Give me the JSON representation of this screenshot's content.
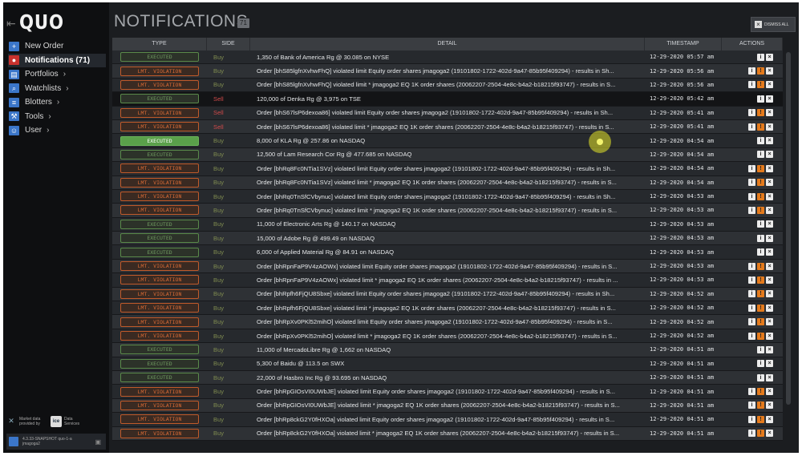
{
  "app": {
    "logo": "QUO"
  },
  "sidebar": {
    "items": [
      {
        "label": "New Order",
        "icon": "plus-icon",
        "chevron": ""
      },
      {
        "label": "Notifications (71)",
        "icon": "bell-icon",
        "chevron": ""
      },
      {
        "label": "Portfolios",
        "icon": "folder-icon",
        "chevron": "›"
      },
      {
        "label": "Watchlists",
        "icon": "search-icon",
        "chevron": "›"
      },
      {
        "label": "Blotters",
        "icon": "blotter-icon",
        "chevron": "›"
      },
      {
        "label": "Tools",
        "icon": "tools-icon",
        "chevron": "›"
      },
      {
        "label": "User",
        "icon": "user-icon",
        "chevron": "›"
      }
    ],
    "market_data": {
      "line1": "Market data",
      "line2": "provided by",
      "brand": "ice",
      "provider1": "Data",
      "provider2": "Services"
    },
    "version": {
      "line1": "4.3.33-SNAPSHOT quo-1-a",
      "line2": "jmagoga2"
    }
  },
  "header": {
    "title": "NOTIFICATIONS",
    "count": "71",
    "dismiss_label": "DISMISS ALL"
  },
  "table": {
    "columns": {
      "type": "TYPE",
      "side": "SIDE",
      "detail": "DETAIL",
      "timestamp": "TIMESTAMP",
      "actions": "ACTIONS"
    },
    "rows": [
      {
        "type": "EXECUTED",
        "side": "Buy",
        "detail": "1,350 of Bank of America Rg @ 30.085 on NYSE",
        "ts": "12-29-2020 05:57 am"
      },
      {
        "type": "LMT. VIOLATION",
        "side": "Buy",
        "detail": "Order [bhS85lgfnXvhwFhQ] violated limit Equity order shares jmagoga2 (19101802-1722-402d-9a47-85b95f409294) - results in Sh...",
        "ts": "12-29-2020 05:56 am"
      },
      {
        "type": "LMT. VIOLATION",
        "side": "Buy",
        "detail": "Order [bhS85lgfnXvhwFhQ] violated limit * jmagoga2 EQ 1K order shares (20062207-2504-4e8c-b4a2-b18215f93747) - results in S...",
        "ts": "12-29-2020 05:56 am"
      },
      {
        "type": "EXECUTED",
        "side": "Sell",
        "detail": "120,000 of Denka Rg @ 3,975 on TSE",
        "ts": "12-29-2020 05:42 am"
      },
      {
        "type": "LMT. VIOLATION",
        "side": "Sell",
        "detail": "Order [bhS67lsP6dexoa86] violated limit Equity order shares jmagoga2 (19101802-1722-402d-9a47-85b95f409294) - results in Sh...",
        "ts": "12-29-2020 05:41 am"
      },
      {
        "type": "LMT. VIOLATION",
        "side": "Sell",
        "detail": "Order [bhS67lsP6dexoa86] violated limit * jmagoga2 EQ 1K order shares (20062207-2504-4e8c-b4a2-b18215f93747) - results in S...",
        "ts": "12-29-2020 05:41 am"
      },
      {
        "type": "EXECUTED",
        "side": "Buy",
        "detail": "8,000 of KLA Rg @ 257.86 on NASDAQ",
        "ts": "12-29-2020 04:54 am"
      },
      {
        "type": "EXECUTED",
        "side": "Buy",
        "detail": "12,500 of Lam Research Cor Rg @ 477.685 on NASDAQ",
        "ts": "12-29-2020 04:54 am"
      },
      {
        "type": "LMT. VIOLATION",
        "side": "Buy",
        "detail": "Order [bhRq8Fc0NTia1SVz] violated limit Equity order shares jmagoga2 (19101802-1722-402d-9a47-85b95f409294) - results in Sh...",
        "ts": "12-29-2020 04:54 am"
      },
      {
        "type": "LMT. VIOLATION",
        "side": "Buy",
        "detail": "Order [bhRq8Fc0NTia1SVz] violated limit * jmagoga2 EQ 1K order shares (20062207-2504-4e8c-b4a2-b18215f93747) - results in S...",
        "ts": "12-29-2020 04:54 am"
      },
      {
        "type": "LMT. VIOLATION",
        "side": "Buy",
        "detail": "Order [bhRq0TnSfCVbynuc] violated limit Equity order shares jmagoga2 (19101802-1722-402d-9a47-85b95f409294) - results in Sh...",
        "ts": "12-29-2020 04:53 am"
      },
      {
        "type": "LMT. VIOLATION",
        "side": "Buy",
        "detail": "Order [bhRq0TnSfCVbynuc] violated limit * jmagoga2 EQ 1K order shares (20062207-2504-4e8c-b4a2-b18215f93747) - results in S...",
        "ts": "12-29-2020 04:53 am"
      },
      {
        "type": "EXECUTED",
        "side": "Buy",
        "detail": "11,000 of Electronic Arts Rg @ 140.17 on NASDAQ",
        "ts": "12-29-2020 04:53 am"
      },
      {
        "type": "EXECUTED",
        "side": "Buy",
        "detail": "15,000 of Adobe Rg @ 499.49 on NASDAQ",
        "ts": "12-29-2020 04:53 am"
      },
      {
        "type": "EXECUTED",
        "side": "Buy",
        "detail": "6,000 of Applied Material Rg @ 84.91 on NASDAQ",
        "ts": "12-29-2020 04:53 am"
      },
      {
        "type": "LMT. VIOLATION",
        "side": "Buy",
        "detail": "Order [bhRpnFaP9V4zAOWx] violated limit Equity order shares jmagoga2 (19101802-1722-402d-9a47-85b95f409294) - results in S...",
        "ts": "12-29-2020 04:53 am"
      },
      {
        "type": "LMT. VIOLATION",
        "side": "Buy",
        "detail": "Order [bhRpnFaP9V4zAOWx] violated limit * jmagoga2 EQ 1K order shares (20062207-2504-4e8c-b4a2-b18215f93747) - results in ...",
        "ts": "12-29-2020 04:53 am"
      },
      {
        "type": "LMT. VIOLATION",
        "side": "Buy",
        "detail": "Order [bhRpfh6FjQU8Sbxe] violated limit Equity order shares jmagoga2 (19101802-1722-402d-9a47-85b95f409294) - results in Sh...",
        "ts": "12-29-2020 04:52 am"
      },
      {
        "type": "LMT. VIOLATION",
        "side": "Buy",
        "detail": "Order [bhRpfh6FjQU8Sbxe] violated limit * jmagoga2 EQ 1K order shares (20062207-2504-4e8c-b4a2-b18215f93747) - results in S...",
        "ts": "12-29-2020 04:52 am"
      },
      {
        "type": "LMT. VIOLATION",
        "side": "Buy",
        "detail": "Order [bhRpXv0PKl52mihO] violated limit Equity order shares jmagoga2 (19101802-1722-402d-9a47-85b95f409294) - results in S...",
        "ts": "12-29-2020 04:52 am"
      },
      {
        "type": "LMT. VIOLATION",
        "side": "Buy",
        "detail": "Order [bhRpXv0PKl52mihO] violated limit * jmagoga2 EQ 1K order shares (20062207-2504-4e8c-b4a2-b18215f93747) - results in S...",
        "ts": "12-29-2020 04:52 am"
      },
      {
        "type": "EXECUTED",
        "side": "Buy",
        "detail": "11,000 of MercadoLibre Rg @ 1,662 on NASDAQ",
        "ts": "12-29-2020 04:51 am"
      },
      {
        "type": "EXECUTED",
        "side": "Buy",
        "detail": "5,300 of Baidu @ 113.5 on SWX",
        "ts": "12-29-2020 04:51 am"
      },
      {
        "type": "EXECUTED",
        "side": "Buy",
        "detail": "22,000 of Hasbro Inc Rg @ 93.695 on NASDAQ",
        "ts": "12-29-2020 04:51 am"
      },
      {
        "type": "LMT. VIOLATION",
        "side": "Buy",
        "detail": "Order [bhRpGIOsVI0UWbJE] violated limit Equity order shares jmagoga2 (19101802-1722-402d-9a47-85b95f409294) - results in S...",
        "ts": "12-29-2020 04:51 am"
      },
      {
        "type": "LMT. VIOLATION",
        "side": "Buy",
        "detail": "Order [bhRpGIOsVI0UWbJE] violated limit * jmagoga2 EQ 1K order shares (20062207-2504-4e8c-b4a2-b18215f93747) - results in S...",
        "ts": "12-29-2020 04:51 am"
      },
      {
        "type": "LMT. VIOLATION",
        "side": "Buy",
        "detail": "Order [bhRp8ckG2Y0fHXOa] violated limit Equity order shares jmagoga2 (19101802-1722-402d-9a47-85b95f409294) - results in S...",
        "ts": "12-29-2020 04:51 am"
      },
      {
        "type": "LMT. VIOLATION",
        "side": "Buy",
        "detail": "Order [bhRp8ckG2Y0fHXOa] violated limit * jmagoga2 EQ 1K order shares (20062207-2504-4e8c-b4a2-b18215f93747) - results in S...",
        "ts": "12-29-2020 04:51 am"
      }
    ]
  },
  "colors": {
    "executed": "#6f9a60",
    "violation": "#d96b35",
    "sell": "#cf4a4a",
    "buy": "#7f8b50",
    "accent": "#3b76c9"
  }
}
